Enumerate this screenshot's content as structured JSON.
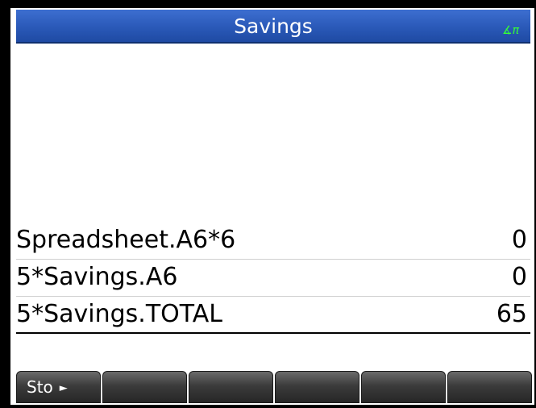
{
  "title_bar": {
    "title": "Savings",
    "angle_mode": "∡π"
  },
  "history": [
    {
      "expression": "Spreadsheet.A6*6",
      "result": "0"
    },
    {
      "expression": "5*Savings.A6",
      "result": "0"
    },
    {
      "expression": "5*Savings.TOTAL",
      "result": "65"
    }
  ],
  "menu": {
    "keys": [
      {
        "label": "Sto",
        "arrow": "►"
      },
      {
        "label": ""
      },
      {
        "label": ""
      },
      {
        "label": ""
      },
      {
        "label": ""
      },
      {
        "label": ""
      }
    ]
  },
  "colors": {
    "title_bar": "#2a59b8",
    "title_text": "#ffffff",
    "angle_indicator": "#35ff35",
    "menu_key": "#3c3c3c",
    "background": "#ffffff",
    "frame": "#000000"
  }
}
